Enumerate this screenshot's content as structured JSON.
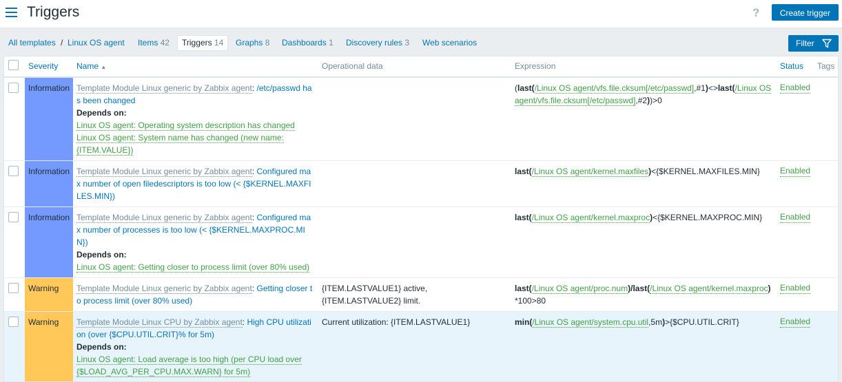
{
  "header": {
    "title": "Triggers",
    "help": "?",
    "create_button": "Create trigger"
  },
  "nav": {
    "all_templates": "All templates",
    "separator": "/",
    "template": "Linux OS agent",
    "items_label": "Items",
    "items_count": "42",
    "triggers_label": "Triggers",
    "triggers_count": "14",
    "graphs_label": "Graphs",
    "graphs_count": "8",
    "dashboards_label": "Dashboards",
    "dashboards_count": "1",
    "discovery_label": "Discovery rules",
    "discovery_count": "3",
    "web_label": "Web scenarios",
    "filter_button": "Filter"
  },
  "table": {
    "columns": {
      "severity": "Severity",
      "name": "Name",
      "sort_indicator": "▲",
      "operational_data": "Operational data",
      "expression": "Expression",
      "status": "Status",
      "tags": "Tags"
    },
    "depends_label": "Depends on:",
    "rows": [
      {
        "severity": "Information",
        "template": "Template Module Linux generic by Zabbix agent",
        "name": "/etc/passwd has been changed",
        "depends": [
          "Linux OS agent: Operating system description has changed",
          "Linux OS agent: System name has changed (new name: {ITEM.VALUE})"
        ],
        "opdata": "",
        "expr": {
          "p1": "(",
          "f1": "last(",
          "i1": "/Linux OS agent/vfs.file.cksum[/etc/passwd]",
          "p2": ",#1",
          "f2": ")",
          "p3": "<>",
          "f3": "last(",
          "i2": "/Linux OS agent/vfs.file.cksum[/etc/passwd]",
          "p4": ",#2",
          "f4": ")",
          "p5": ")>0"
        },
        "status": "Enabled"
      },
      {
        "severity": "Information",
        "template": "Template Module Linux generic by Zabbix agent",
        "name": "Configured max number of open filedescriptors is too low (< {$KERNEL.MAXFILES.MIN})",
        "opdata": "",
        "expr": {
          "f1": "last(",
          "i1": "/Linux OS agent/kernel.maxfiles",
          "f2": ")",
          "p1": "<{$KERNEL.MAXFILES.MIN}"
        },
        "status": "Enabled"
      },
      {
        "severity": "Information",
        "template": "Template Module Linux generic by Zabbix agent",
        "name": "Configured max number of processes is too low (< {$KERNEL.MAXPROC.MIN})",
        "depends": [
          "Linux OS agent: Getting closer to process limit (over 80% used)"
        ],
        "opdata": "",
        "expr": {
          "f1": "last(",
          "i1": "/Linux OS agent/kernel.maxproc",
          "f2": ")",
          "p1": "<{$KERNEL.MAXPROC.MIN}"
        },
        "status": "Enabled"
      },
      {
        "severity": "Warning",
        "template": "Template Module Linux generic by Zabbix agent",
        "name": "Getting closer to process limit (over 80% used)",
        "opdata": "{ITEM.LASTVALUE1} active, {ITEM.LASTVALUE2} limit.",
        "expr": {
          "f1": "last(",
          "i1": "/Linux OS agent/proc.num",
          "f2": ")/last(",
          "i2": "/Linux OS agent/kernel.maxproc",
          "f3": ")",
          "p1": "*100>80"
        },
        "status": "Enabled"
      },
      {
        "severity": "Warning",
        "template": "Template Module Linux CPU by Zabbix agent",
        "name": "High CPU utilization (over {$CPU.UTIL.CRIT}% for 5m)",
        "depends": [
          "Linux OS agent: Load average is too high (per CPU load over {$LOAD_AVG_PER_CPU.MAX.WARN} for 5m)"
        ],
        "opdata": "Current utilization: {ITEM.LASTVALUE1}",
        "expr": {
          "f1": "min(",
          "i1": "/Linux OS agent/system.cpu.util",
          "p1": ",5m",
          "f2": ")",
          "p2": ">{$CPU.UTIL.CRIT}"
        },
        "status": "Enabled"
      }
    ]
  },
  "colors": {
    "accent": "#0275b8",
    "information": "#7499ff",
    "warning": "#ffc859",
    "enabled": "#429e47",
    "highlight_row": "#e8f4fc"
  }
}
